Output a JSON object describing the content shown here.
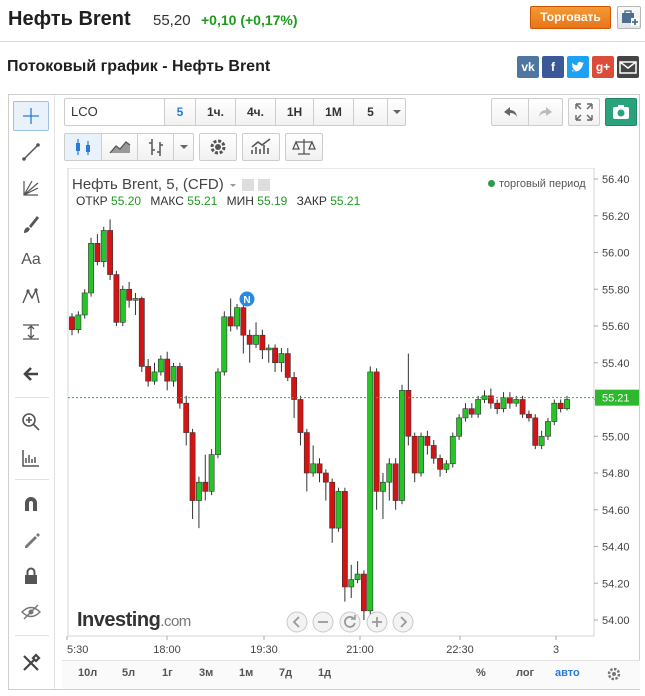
{
  "header": {
    "title": "Нефть Brent",
    "price": "55,20",
    "change": "+0,10 (+0,17%)",
    "trade_button": "Торговать"
  },
  "section_title": "Потоковый график - Нефть Brent",
  "socials": [
    "vk",
    "facebook",
    "twitter",
    "google-plus",
    "mail"
  ],
  "toolbar": {
    "symbol": "LCO",
    "intervals": [
      "5",
      "1ч.",
      "4ч.",
      "1Н",
      "1М"
    ],
    "selected_interval": "5",
    "interval_dropdown": "5"
  },
  "chart_header": {
    "title": "Нефть Brent, 5, (CFD)",
    "open_label": "ОТКР",
    "open": "55.20",
    "high_label": "МАКС",
    "high": "55.21",
    "low_label": "МИН",
    "low": "55.19",
    "close_label": "ЗАКР",
    "close": "55.21",
    "period_label": "торговый период",
    "current_price_tag": "55.21",
    "news_marker": "N",
    "logo_main": "Investing",
    "logo_suffix": ".com"
  },
  "bottom_bar": {
    "ranges": [
      "10л",
      "5л",
      "1г",
      "3м",
      "1м",
      "7д",
      "1д"
    ],
    "percent": "%",
    "log": "лог",
    "auto": "авто"
  },
  "colors": {
    "up": "#27c427",
    "down": "#d41414",
    "accent": "#2a7bd8",
    "trade": "#e8801f"
  },
  "chart_data": {
    "type": "candlestick",
    "y_ticks": [
      "56.40",
      "56.20",
      "56.00",
      "55.80",
      "55.60",
      "55.40",
      "55.20",
      "55.00",
      "54.80",
      "54.60",
      "54.40",
      "54.20",
      "54.00"
    ],
    "ylim": [
      53.95,
      56.45
    ],
    "x_ticks": [
      "5:30",
      "18:00",
      "19:30",
      "21:00",
      "22:30",
      "3"
    ],
    "current_price": 55.21,
    "candles": [
      [
        55.65,
        55.58,
        55.67,
        55.55
      ],
      [
        55.58,
        55.66,
        55.68,
        55.56
      ],
      [
        55.66,
        55.78,
        55.8,
        55.64
      ],
      [
        55.78,
        56.05,
        56.08,
        55.76
      ],
      [
        56.05,
        55.95,
        56.1,
        55.93
      ],
      [
        55.95,
        56.12,
        56.14,
        55.92
      ],
      [
        56.12,
        55.88,
        56.18,
        55.85
      ],
      [
        55.88,
        55.62,
        55.9,
        55.6
      ],
      [
        55.62,
        55.8,
        55.82,
        55.6
      ],
      [
        55.8,
        55.74,
        55.84,
        55.7
      ],
      [
        55.74,
        55.75,
        55.78,
        55.66
      ],
      [
        55.75,
        55.38,
        55.76,
        55.35
      ],
      [
        55.38,
        55.3,
        55.42,
        55.27
      ],
      [
        55.3,
        55.35,
        55.4,
        55.28
      ],
      [
        55.35,
        55.42,
        55.44,
        55.33
      ],
      [
        55.42,
        55.3,
        55.46,
        55.25
      ],
      [
        55.3,
        55.38,
        55.4,
        55.27
      ],
      [
        55.38,
        55.18,
        55.4,
        55.15
      ],
      [
        55.18,
        55.02,
        55.22,
        54.95
      ],
      [
        55.02,
        54.65,
        55.04,
        54.55
      ],
      [
        54.65,
        54.75,
        54.78,
        54.5
      ],
      [
        54.75,
        54.7,
        54.9,
        54.65
      ],
      [
        54.7,
        54.9,
        54.93,
        54.68
      ],
      [
        54.9,
        55.35,
        55.37,
        54.88
      ],
      [
        55.35,
        55.65,
        55.68,
        55.33
      ],
      [
        55.65,
        55.6,
        55.75,
        55.57
      ],
      [
        55.6,
        55.7,
        55.72,
        55.58
      ],
      [
        55.7,
        55.55,
        55.72,
        55.45
      ],
      [
        55.55,
        55.5,
        55.58,
        55.4
      ],
      [
        55.5,
        55.55,
        55.62,
        55.48
      ],
      [
        55.55,
        55.47,
        55.58,
        55.42
      ],
      [
        55.47,
        55.48,
        55.5,
        55.4
      ],
      [
        55.48,
        55.4,
        55.5,
        55.35
      ],
      [
        55.4,
        55.45,
        55.48,
        55.35
      ],
      [
        55.45,
        55.32,
        55.48,
        55.3
      ],
      [
        55.32,
        55.2,
        55.35,
        55.1
      ],
      [
        55.2,
        55.02,
        55.22,
        54.95
      ],
      [
        55.02,
        54.8,
        55.04,
        54.7
      ],
      [
        54.8,
        54.85,
        54.95,
        54.78
      ],
      [
        54.85,
        54.8,
        54.88,
        54.75
      ],
      [
        54.8,
        54.75,
        54.82,
        54.65
      ],
      [
        54.75,
        54.5,
        54.77,
        54.42
      ],
      [
        54.5,
        54.7,
        54.72,
        54.48
      ],
      [
        54.7,
        54.18,
        54.72,
        54.1
      ],
      [
        54.18,
        54.22,
        54.3,
        54.12
      ],
      [
        54.22,
        54.25,
        54.32,
        54.2
      ],
      [
        54.25,
        54.05,
        54.27,
        54.0
      ],
      [
        54.05,
        55.35,
        55.38,
        54.03
      ],
      [
        55.35,
        54.7,
        55.37,
        54.6
      ],
      [
        54.7,
        54.75,
        54.8,
        54.55
      ],
      [
        54.75,
        54.85,
        54.88,
        54.65
      ],
      [
        54.85,
        54.65,
        54.88,
        54.6
      ],
      [
        54.65,
        55.25,
        55.28,
        54.63
      ],
      [
        55.25,
        55.0,
        55.45,
        54.95
      ],
      [
        55.0,
        54.8,
        55.02,
        54.75
      ],
      [
        54.8,
        55.0,
        55.02,
        54.78
      ],
      [
        55.0,
        54.95,
        55.03,
        54.9
      ],
      [
        54.95,
        54.88,
        54.98,
        54.85
      ],
      [
        54.88,
        54.82,
        54.9,
        54.78
      ],
      [
        54.82,
        54.85,
        54.87,
        54.8
      ],
      [
        54.85,
        55.0,
        55.02,
        54.83
      ],
      [
        55.0,
        55.1,
        55.12,
        54.98
      ],
      [
        55.1,
        55.15,
        55.18,
        55.08
      ],
      [
        55.15,
        55.12,
        55.18,
        55.1
      ],
      [
        55.12,
        55.2,
        55.22,
        55.1
      ],
      [
        55.2,
        55.22,
        55.25,
        55.18
      ],
      [
        55.22,
        55.18,
        55.26,
        55.15
      ],
      [
        55.18,
        55.15,
        55.2,
        55.12
      ],
      [
        55.15,
        55.21,
        55.24,
        55.13
      ],
      [
        55.21,
        55.18,
        55.24,
        55.15
      ],
      [
        55.18,
        55.2,
        55.22,
        55.16
      ],
      [
        55.2,
        55.12,
        55.22,
        55.1
      ],
      [
        55.12,
        55.1,
        55.14,
        55.08
      ],
      [
        55.1,
        54.95,
        55.12,
        54.93
      ],
      [
        54.95,
        55.0,
        55.03,
        54.93
      ],
      [
        55.0,
        55.08,
        55.1,
        54.98
      ],
      [
        55.08,
        55.18,
        55.2,
        55.06
      ],
      [
        55.18,
        55.15,
        55.2,
        55.13
      ],
      [
        55.15,
        55.2,
        55.22,
        55.14
      ]
    ]
  }
}
